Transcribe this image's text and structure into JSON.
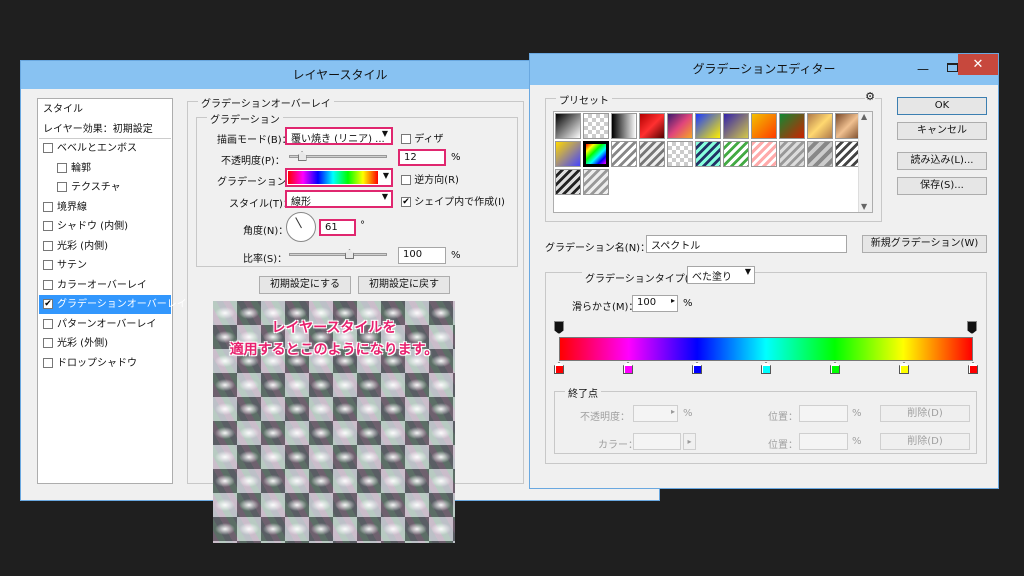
{
  "layer_style": {
    "title": "レイヤースタイル",
    "sidebar": [
      {
        "label": "スタイル",
        "check": null
      },
      {
        "label": "レイヤー効果：初期設定",
        "check": null
      },
      {
        "label": "ベベルとエンボス",
        "check": false
      },
      {
        "label": "輪郭",
        "check": false,
        "indent": true
      },
      {
        "label": "テクスチャ",
        "check": false,
        "indent": true
      },
      {
        "label": "境界線",
        "check": false
      },
      {
        "label": "シャドウ (内側)",
        "check": false
      },
      {
        "label": "光彩 (内側)",
        "check": false
      },
      {
        "label": "サテン",
        "check": false
      },
      {
        "label": "カラーオーバーレイ",
        "check": false
      },
      {
        "label": "グラデーションオーバーレイ",
        "check": true,
        "selected": true
      },
      {
        "label": "パターンオーバーレイ",
        "check": false
      },
      {
        "label": "光彩 (外側)",
        "check": false
      },
      {
        "label": "ドロップシャドウ",
        "check": false
      }
    ],
    "group_title": "グラデーションオーバーレイ",
    "sub_group_title": "グラデーション",
    "blend_mode_label": "描画モード(B)：",
    "blend_mode_value": "覆い焼き (リニア) ...",
    "dither_label": "ディザ",
    "dither_checked": false,
    "opacity_label": "不透明度(P)：",
    "opacity_value": "12",
    "opacity_fraction": 0.12,
    "percent": "%",
    "gradient_label": "グラデーション：",
    "reverse_label": "逆方向(R)",
    "reverse_checked": false,
    "style_label": "スタイル(T)：",
    "style_value": "線形",
    "align_label": "シェイプ内で作成(I)",
    "align_checked": true,
    "angle_label": "角度(N)：",
    "angle_value": "61",
    "degree": "°",
    "scale_label": "比率(S)：",
    "scale_value": "100",
    "make_default": "初期設定にする",
    "reset_default": "初期設定に戻す",
    "overlay_line1": "レイヤースタイルを",
    "overlay_line2": "適用するとこのようになります。"
  },
  "gradient_editor": {
    "title": "グラデーションエディター",
    "presets_label": "プリセット",
    "gear_icon": "gear-icon",
    "ok": "OK",
    "cancel": "キャンセル",
    "load": "読み込み(L)...",
    "save": "保存(S)...",
    "name_label": "グラデーション名(N)：",
    "name_value": "スペクトル",
    "new_button": "新規グラデーション(W)",
    "type_label": "グラデーションタイプ(T)：",
    "type_value": "べた塗り",
    "smooth_label": "滑らかさ(M)：",
    "smooth_value": "100",
    "percent": "%",
    "stops_group": "終了点",
    "opacity_label": "不透明度：",
    "location_label": "位置：",
    "delete_label": "削除(D)",
    "color_label": "カラー：",
    "color_stops": [
      "#ff0000",
      "#ff00ff",
      "#0000ff",
      "#00ffff",
      "#00ff00",
      "#ffff00",
      "#ff0000"
    ]
  }
}
